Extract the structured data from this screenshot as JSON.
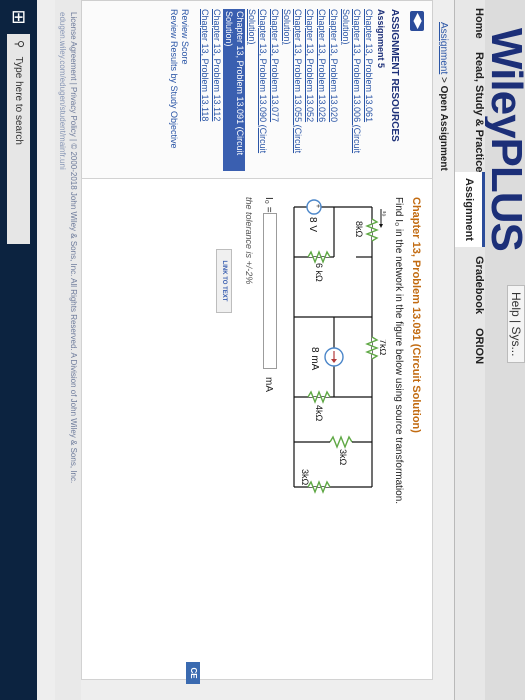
{
  "brand": {
    "logo_text": "WileyPLUS",
    "help_link": "Help | Sys..."
  },
  "nav": {
    "tabs": [
      "Home",
      "Read, Study & Practice",
      "Assignment",
      "Gradebook",
      "ORION"
    ],
    "active_tab": "Assignment"
  },
  "breadcrumb": {
    "link": "Assignment",
    "sep": ">",
    "current": "Open Assignment"
  },
  "sidebar": {
    "icon_label": "◀▶",
    "title": "ASSIGNMENT RESOURCES",
    "assignment": "Assignment 5",
    "items": [
      {
        "label": "Chapter 13, Problem 13.061",
        "selected": false
      },
      {
        "label": "Chapter 13, Problem 13.006 (Circuit Solution)",
        "selected": false
      },
      {
        "label": "Chapter 13, Problem 13.020",
        "selected": false
      },
      {
        "label": "Chapter 13, Problem 13.026",
        "selected": false
      },
      {
        "label": "Chapter 13, Problem 13.052",
        "selected": false
      },
      {
        "label": "Chapter 13, Problem 13.055 (Circuit Solution)",
        "selected": false
      },
      {
        "label": "Chapter 13, Problem 13.077",
        "selected": false
      },
      {
        "label": "Chapter 13, Problem 13.090 (Circuit Solution)",
        "selected": false
      },
      {
        "label": "Chapter 13, Problem 13.091 (Circuit Solution)",
        "selected": true
      },
      {
        "label": "Chapter 13, Problem 13.112",
        "selected": false
      },
      {
        "label": "Chapter 13, Problem 13.118",
        "selected": false
      }
    ],
    "links": [
      "Review Score",
      "Review Results by Study Objective"
    ]
  },
  "problem": {
    "title": "Chapter 13, Problem 13.091 (Circuit Solution)",
    "prompt": "Find I₀ in the network in the figure below using source transformation.",
    "circuit_labels": {
      "current": "I₀",
      "r_top": "7kΩ",
      "r_left": "8kΩ",
      "r_mid_left": "6 kΩ",
      "r_mid": "4kΩ",
      "r_right1": "3kΩ",
      "r_right2": "3kΩ",
      "vsource": "8 V",
      "isource": "8 mA"
    },
    "answer_label": "I₀ =",
    "answer_value": "",
    "answer_unit": "mA",
    "tolerance": "the tolerance is +/-2%",
    "link_text": "LINK TO TEXT"
  },
  "footer": {
    "line1": "License Agreement | Privacy Policy | © 2000-2018 John Wiley & Sons, Inc. All Rights Reserved. A Division of John Wiley & Sons, Inc.",
    "line2": "edugen.wiley.com/edugen/student/mainfr.uni"
  },
  "taskbar": {
    "start_icon": "⊞",
    "search_placeholder": "Type here to search"
  },
  "edge_tab": "CE"
}
